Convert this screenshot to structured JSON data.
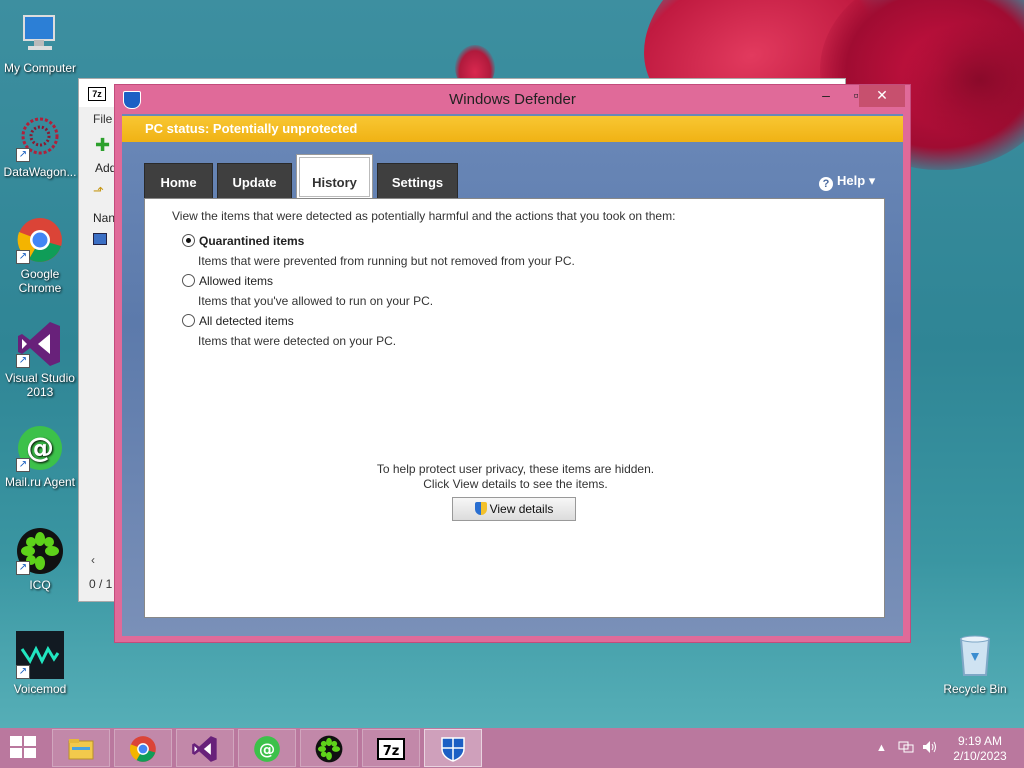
{
  "desktop": {
    "icons": [
      {
        "label": "My Computer"
      },
      {
        "label": "DataWagon..."
      },
      {
        "label": "Google Chrome"
      },
      {
        "label": "Visual Studio 2013"
      },
      {
        "label": "Mail.ru Agent"
      },
      {
        "label": "ICQ"
      },
      {
        "label": "Voicemod"
      },
      {
        "label": "Recycle Bin"
      }
    ]
  },
  "zip_window": {
    "logo": "7z",
    "menu_file": "File",
    "add_label": "Add",
    "name_col": "Nan",
    "status": "0 / 1"
  },
  "defender": {
    "title": "Windows Defender",
    "status": "PC status: Potentially unprotected",
    "status_color": "#f0b214",
    "tabs": [
      {
        "label": "Home"
      },
      {
        "label": "Update"
      },
      {
        "label": "History"
      },
      {
        "label": "Settings"
      }
    ],
    "active_tab": "History",
    "help": "Help",
    "intro": "View the items that were detected as potentially harmful and the actions that you took on them:",
    "options": [
      {
        "label": "Quarantined items",
        "description": "Items that were prevented from running but not removed from your PC.",
        "selected": true
      },
      {
        "label": "Allowed items",
        "description": "Items that you've allowed to run on your PC.",
        "selected": false
      },
      {
        "label": "All detected items",
        "description": "Items that were detected on your PC.",
        "selected": false
      }
    ],
    "privacy_line1": "To help protect user privacy, these items are hidden.",
    "privacy_line2": "Click View details to see the items.",
    "view_details": "View details"
  },
  "taskbar": {
    "apps": [
      "file-explorer",
      "google-chrome",
      "visual-studio",
      "mail-ru-agent",
      "icq",
      "7-zip",
      "windows-defender"
    ],
    "active_app": "windows-defender",
    "time": "9:19 AM",
    "date": "2/10/2023"
  }
}
